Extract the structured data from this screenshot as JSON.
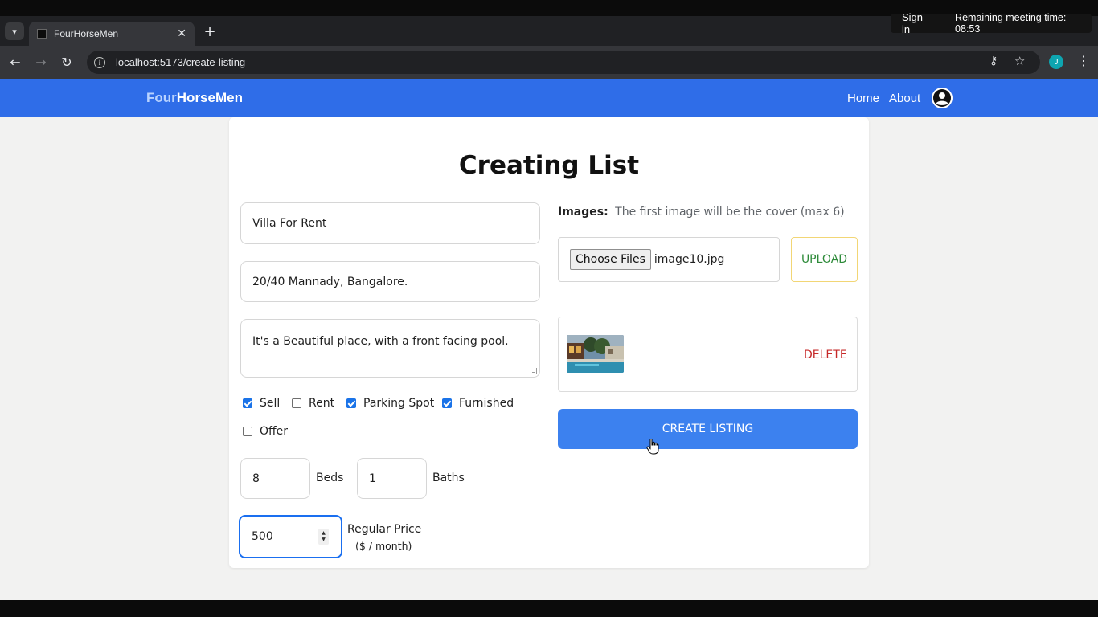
{
  "browser": {
    "tab_title": "FourHorseMen",
    "new_tab": "+",
    "close_tab": "✕",
    "url": "localhost:5173/create-listing",
    "profile_initial": "J",
    "overlay": {
      "sign_in": "Sign in",
      "remaining": "Remaining meeting time: 08:53"
    }
  },
  "header": {
    "brand_part1": "Four",
    "brand_part2": "HorseMen",
    "nav": {
      "home": "Home",
      "about": "About"
    },
    "colors": {
      "bar": "#2f6de8",
      "brand_light": "#b9d3ff"
    }
  },
  "form": {
    "title": "Creating List",
    "name": "Villa For Rent",
    "address": "20/40 Mannady, Bangalore.",
    "description": "It's a Beautiful place, with a front facing pool.",
    "options": [
      {
        "label": "Sell",
        "checked": true
      },
      {
        "label": "Rent",
        "checked": false
      },
      {
        "label": "Parking Spot",
        "checked": true
      },
      {
        "label": "Furnished",
        "checked": true
      },
      {
        "label": "Offer",
        "checked": false
      }
    ],
    "beds": {
      "value": "8",
      "label": "Beds"
    },
    "baths": {
      "value": "1",
      "label": "Baths"
    },
    "price": {
      "value": "500",
      "label": "Regular Price",
      "unit": "($ / month)"
    }
  },
  "images": {
    "heading": "Images:",
    "hint": "The first image will be the cover (max 6)",
    "choose_label": "Choose Files",
    "file_name": "image10.jpg",
    "upload_label": "UPLOAD",
    "delete_label": "DELETE"
  },
  "actions": {
    "create_label": "CREATE LISTING",
    "accent": "#3c81ef"
  }
}
